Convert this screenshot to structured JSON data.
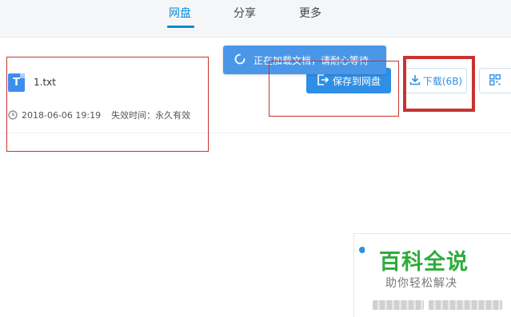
{
  "nav": {
    "tabs": [
      {
        "label": "网盘",
        "active": true
      },
      {
        "label": "分享",
        "active": false
      },
      {
        "label": "更多",
        "active": false
      }
    ]
  },
  "file": {
    "icon_letter": "T",
    "name": "1.txt",
    "date": "2018-06-06 19:19",
    "expire": "失效时间：永久有效"
  },
  "actions": {
    "save_label": "保存到网盘",
    "download_label": "下载(6B)"
  },
  "toast": {
    "message": "正在加载文档，请耐心等待"
  },
  "watermark": {
    "title": "百科全说",
    "subtitle": "助你轻松解决"
  },
  "colors": {
    "accent": "#0d8ad8",
    "button_blue": "#2f8fe6",
    "annotation_red": "#c8332f",
    "watermark_green": "#2eab3c"
  }
}
